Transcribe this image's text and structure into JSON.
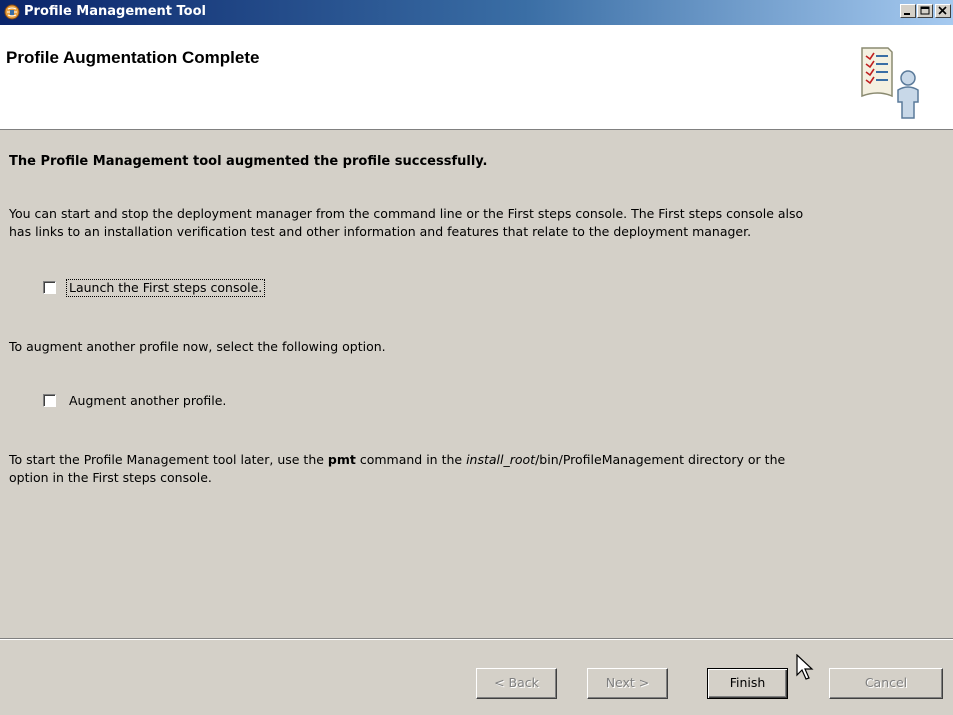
{
  "window": {
    "title": "Profile Management Tool",
    "icons": {
      "app": "globe-app-icon",
      "minimize": "minimize-icon",
      "maximize": "maximize-icon",
      "close": "close-icon"
    }
  },
  "header": {
    "title": "Profile Augmentation Complete",
    "icon": "checklist-person-icon"
  },
  "content": {
    "headline": "The Profile Management tool augmented the profile successfully.",
    "paragraph1_line1": "You can start and stop the deployment manager from the command line or the First steps console. The First steps console also",
    "paragraph1_line2": "has links to an installation verification test and other information and features that relate to the deployment manager.",
    "launch_checkbox": {
      "label": "Launch the First steps console.",
      "checked": false
    },
    "augment_intro": "To augment another profile now, select the following option.",
    "augment_checkbox": {
      "label": "Augment another profile.",
      "checked": false
    },
    "later": {
      "prefix": "To start the Profile Management tool later, use the ",
      "command": "pmt",
      "middle": " command in the ",
      "path_italic": "install_root",
      "path_rest": "/bin/ProfileManagement directory or the",
      "line2": "option in the First steps console."
    }
  },
  "buttons": {
    "back": "< Back",
    "next": "Next >",
    "finish": "Finish",
    "cancel": "Cancel"
  },
  "colors": {
    "titlebar_start": "#0a246a",
    "titlebar_end": "#a6caf0",
    "dialog_bg": "#d4d0c8",
    "header_bg": "#ffffff",
    "disabled_text": "#808080"
  }
}
